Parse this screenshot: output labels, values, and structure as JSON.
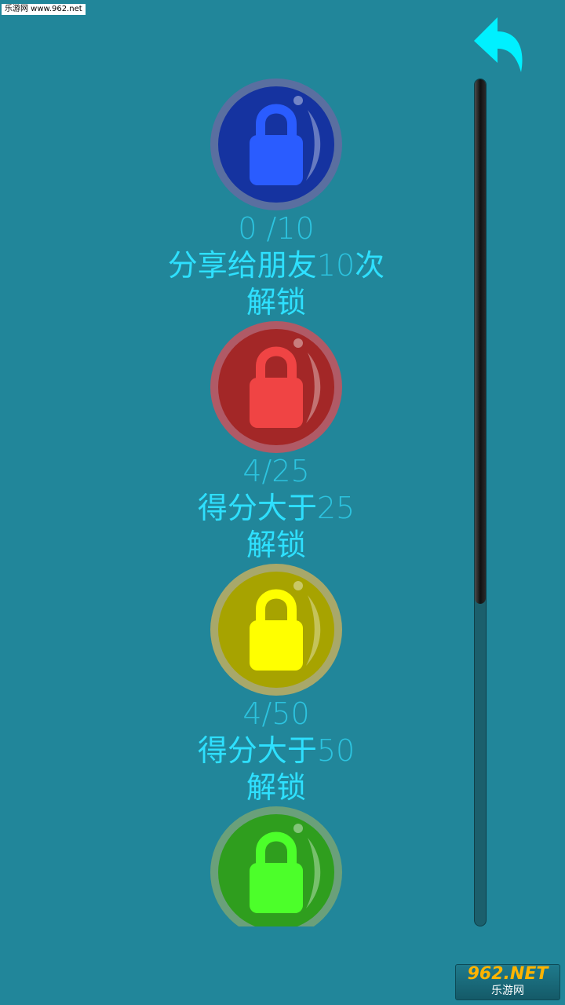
{
  "watermark_top": "乐游网 www.962.net",
  "watermark_bottom": {
    "line1": "962.NET",
    "line2": "乐游网"
  },
  "back_button": {
    "icon": "back-arrow-icon",
    "color": "#00f0ff"
  },
  "scrollbar": {
    "position_fraction": 0.0,
    "visible_fraction": 0.62
  },
  "items": [
    {
      "ring": "#5a6fa0",
      "fill": "#1533a0",
      "lock": "#2a5cff",
      "progress": "0 /10",
      "cond_text": "分享给朋友",
      "cond_num": "10",
      "cond_suffix": "次",
      "unlock": "解锁"
    },
    {
      "ring": "#b05a66",
      "fill": "#a32727",
      "lock": "#f04444",
      "progress": "4/25",
      "cond_text": "得分大于",
      "cond_num": "25",
      "cond_suffix": "",
      "unlock": "解锁"
    },
    {
      "ring": "#a8a86a",
      "fill": "#a7a300",
      "lock": "#ffff00",
      "progress": "4/50",
      "cond_text": "得分大于",
      "cond_num": "50",
      "cond_suffix": "",
      "unlock": "解锁"
    },
    {
      "ring": "#6aa07a",
      "fill": "#2f9e1e",
      "lock": "#4cff2a",
      "progress": "",
      "cond_text": "",
      "cond_num": "",
      "cond_suffix": "",
      "unlock": ""
    }
  ]
}
